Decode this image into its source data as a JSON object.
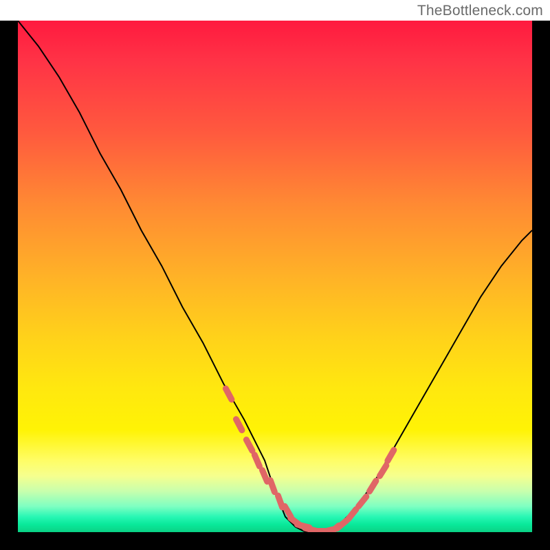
{
  "watermark": "TheBottleneck.com",
  "chart_data": {
    "type": "line",
    "title": "",
    "xlabel": "",
    "ylabel": "",
    "xlim": [
      0,
      100
    ],
    "ylim": [
      0,
      100
    ],
    "grid": false,
    "series": [
      {
        "name": "bottleneck-curve",
        "x": [
          0,
          4,
          8,
          12,
          16,
          20,
          24,
          28,
          32,
          36,
          40,
          44,
          48,
          50,
          52,
          54,
          56,
          58,
          60,
          62,
          66,
          70,
          74,
          78,
          82,
          86,
          90,
          94,
          98,
          100
        ],
        "y": [
          100,
          95,
          89,
          82,
          74,
          67,
          59,
          52,
          44,
          37,
          29,
          22,
          14,
          8,
          3,
          1,
          0,
          0,
          0,
          1,
          5,
          11,
          18,
          25,
          32,
          39,
          46,
          52,
          57,
          59
        ]
      }
    ],
    "markers": {
      "name": "highlight-points",
      "color": "#e06666",
      "x": [
        41,
        43,
        45,
        46.5,
        48,
        49.5,
        51,
        52.5,
        54,
        55.5,
        57,
        58.5,
        60,
        61.5,
        63,
        65,
        67,
        69,
        71,
        72.5
      ],
      "y": [
        27,
        21,
        17,
        14,
        11,
        9,
        6,
        4,
        2,
        1.2,
        0.5,
        0.2,
        0.2,
        0.5,
        1.5,
        3.5,
        6,
        9,
        12,
        15
      ]
    },
    "background_gradient": {
      "top": "#ff1a3f",
      "mid": "#ffd21a",
      "bottom": "#0ad184"
    }
  }
}
